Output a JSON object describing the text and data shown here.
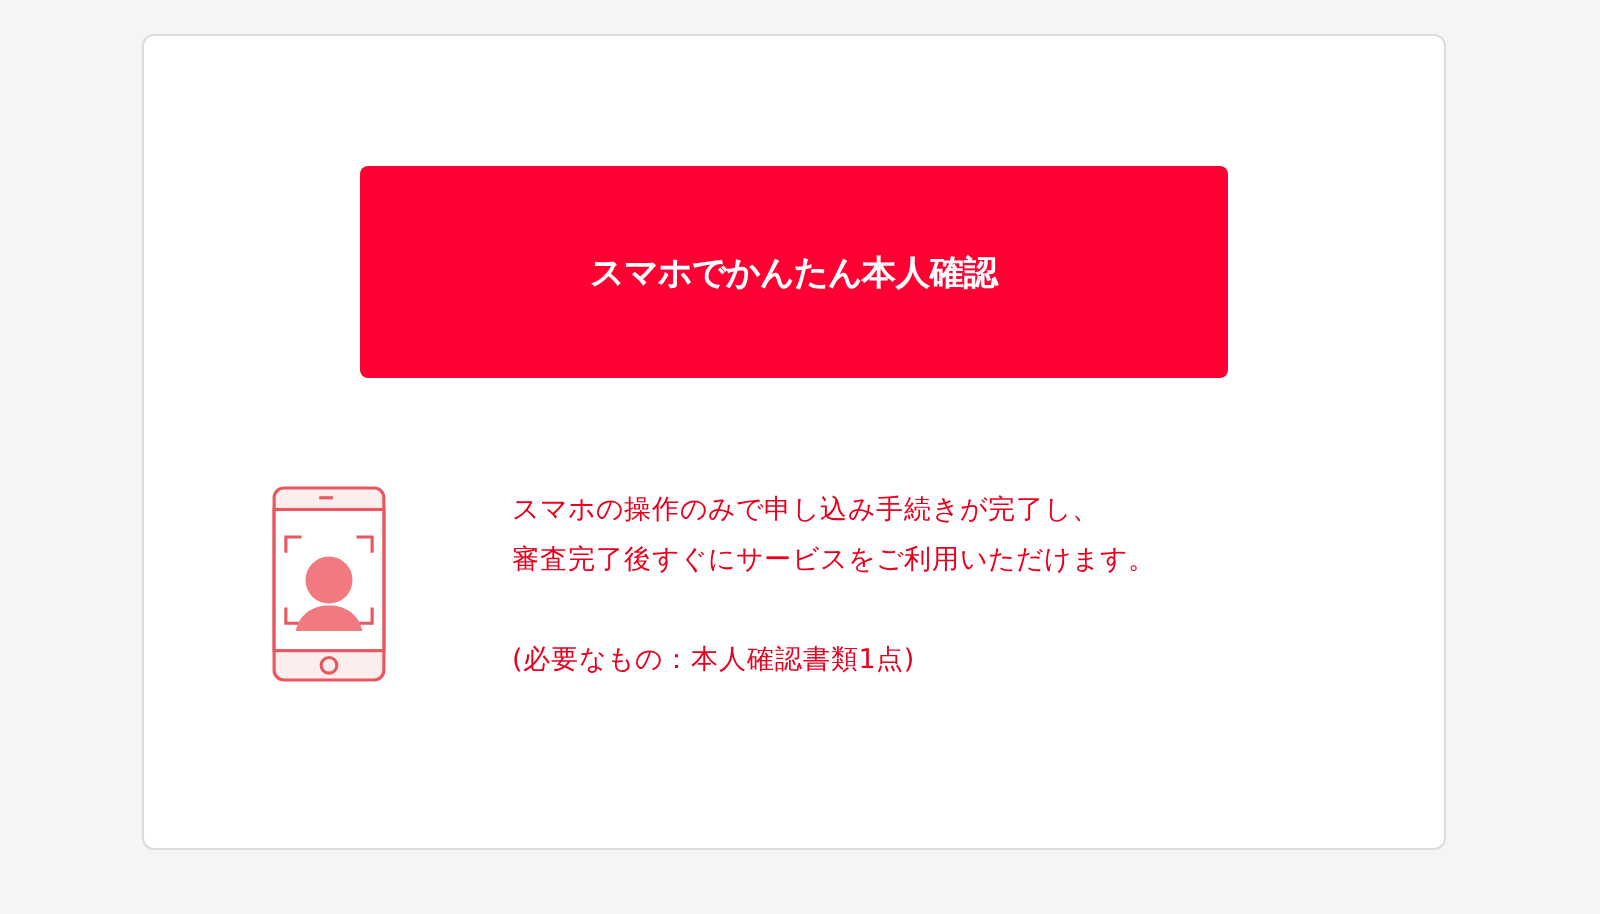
{
  "verify_button": {
    "label": "スマホでかんたん本人確認"
  },
  "description": {
    "lines": [
      "スマホの操作のみで申し込み手続きが完了し、",
      "審査完了後すぐにサービスをご利用いただけます。"
    ]
  },
  "note": "(必要なもの：本人確認書類1点)"
}
